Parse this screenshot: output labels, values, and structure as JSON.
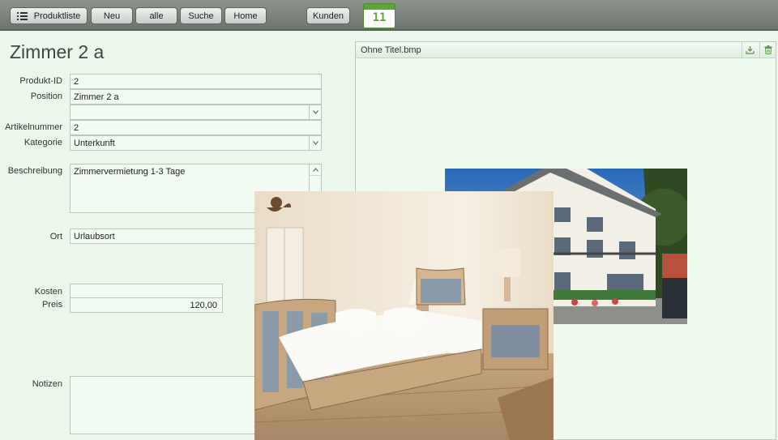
{
  "toolbar": {
    "buttons": [
      "Produktliste",
      "Neu",
      "alle",
      "Suche",
      "Home",
      "Kunden"
    ],
    "calendar_day": "11"
  },
  "record": {
    "title": "Zimmer 2 a",
    "labels": {
      "produkt_id": "Produkt-ID",
      "position": "Position",
      "artikelnummer": "Artikelnummer",
      "kategorie": "Kategorie",
      "beschreibung": "Beschreibung",
      "ort": "Ort",
      "kosten": "Kosten",
      "preis": "Preis",
      "notizen": "Notizen"
    },
    "values": {
      "produkt_id": "2",
      "position": "Zimmer 2 a",
      "artikelnummer": "2",
      "kategorie": "Unterkunft",
      "beschreibung": "Zimmervermietung 1-3 Tage",
      "ort": "Urlaubsort",
      "kosten": "",
      "preis": "120,00",
      "notizen": ""
    }
  },
  "image_panel": {
    "filename": "Ohne Titel.bmp"
  },
  "icons": [
    "list-icon",
    "calendar-icon",
    "export-icon",
    "trash-icon",
    "chevron-down-icon",
    "chevron-up-icon"
  ],
  "colors": {
    "background": "#eaf7ea",
    "toolbar": "#7a807a",
    "calendar_accent": "#5da636"
  }
}
